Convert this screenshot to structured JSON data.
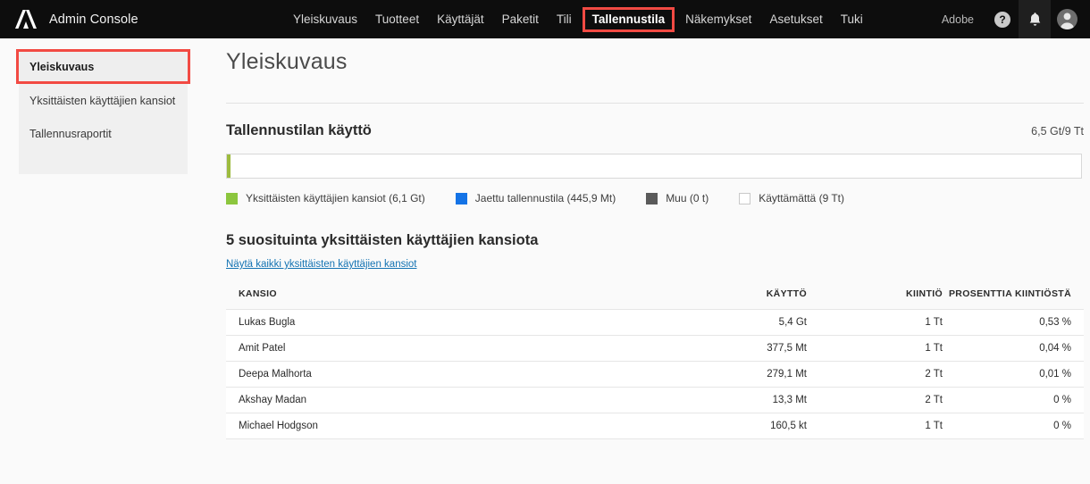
{
  "topbar": {
    "logo_icon": "adobe-logo-icon",
    "brand_title": "Admin Console",
    "nav": [
      {
        "label": "Yleiskuvaus",
        "active": false
      },
      {
        "label": "Tuotteet",
        "active": false
      },
      {
        "label": "Käyttäjät",
        "active": false
      },
      {
        "label": "Paketit",
        "active": false
      },
      {
        "label": "Tili",
        "active": false
      },
      {
        "label": "Tallennustila",
        "active": true
      },
      {
        "label": "Näkemykset",
        "active": false
      },
      {
        "label": "Asetukset",
        "active": false
      },
      {
        "label": "Tuki",
        "active": false
      }
    ],
    "org_label": "Adobe",
    "help_icon": "help-question-icon",
    "bell_icon": "notifications-bell-icon",
    "avatar_icon": "user-avatar-icon",
    "highlight_color": "#f24a43"
  },
  "sidebar": {
    "items": [
      {
        "label": "Yleiskuvaus",
        "selected": true
      },
      {
        "label": "Yksittäisten käyttäjien kansiot",
        "selected": false
      },
      {
        "label": "Tallennusraportit",
        "selected": false
      }
    ]
  },
  "main": {
    "page_title": "Yleiskuvaus",
    "storage": {
      "title": "Tallennustilan käyttö",
      "value": "6,5 Gt/9 Tt",
      "legend": [
        {
          "label": "Yksittäisten käyttäjien kansiot (6,1 Gt)",
          "color": "#8cc63e",
          "swatch": "filled"
        },
        {
          "label": "Jaettu tallennustila (445,9 Mt)",
          "color": "#1473e6",
          "swatch": "filled"
        },
        {
          "label": "Muu (0 t)",
          "color": "#5a5a5a",
          "swatch": "filled"
        },
        {
          "label": "Käyttämättä (9 Tt)",
          "color": "#ffffff",
          "swatch": "empty"
        }
      ]
    },
    "top_folders": {
      "title": "5 suosituinta yksittäisten käyttäjien kansiota",
      "link_label": "Näytä kaikki yksittäisten käyttäjien kansiot",
      "columns": [
        "KANSIO",
        "KÄYTTÖ",
        "KIINTIÖ",
        "PROSENTTIA KIINTIÖSTÄ"
      ],
      "rows": [
        {
          "folder": "Lukas Bugla",
          "usage": "5,4 Gt",
          "quota": "1 Tt",
          "percent": "0,53 %"
        },
        {
          "folder": "Amit Patel",
          "usage": "377,5 Mt",
          "quota": "1 Tt",
          "percent": "0,04 %"
        },
        {
          "folder": "Deepa Malhorta",
          "usage": "279,1 Mt",
          "quota": "2 Tt",
          "percent": "0,01 %"
        },
        {
          "folder": "Akshay Madan",
          "usage": "13,3 Mt",
          "quota": "2 Tt",
          "percent": "0 %"
        },
        {
          "folder": "Michael Hodgson",
          "usage": "160,5 kt",
          "quota": "1 Tt",
          "percent": "0 %"
        }
      ]
    }
  },
  "chart_data": {
    "type": "bar",
    "title": "Tallennustilan käyttö",
    "orientation": "horizontal-stacked",
    "total_label": "6,5 Gt/9 Tt",
    "categories": [
      "Yksittäisten käyttäjien kansiot",
      "Jaettu tallennustila",
      "Muu",
      "Käyttämättä"
    ],
    "values": [
      6.1,
      0.4459,
      0,
      9216
    ],
    "units": [
      "Gt",
      "Gt",
      "Gt",
      "Gt"
    ],
    "value_labels": [
      "6,1 Gt",
      "445,9 Mt",
      "0 t",
      "9 Tt"
    ],
    "colors": [
      "#8cc63e",
      "#1473e6",
      "#5a5a5a",
      "#ffffff"
    ],
    "legend_position": "bottom",
    "grid": false
  }
}
